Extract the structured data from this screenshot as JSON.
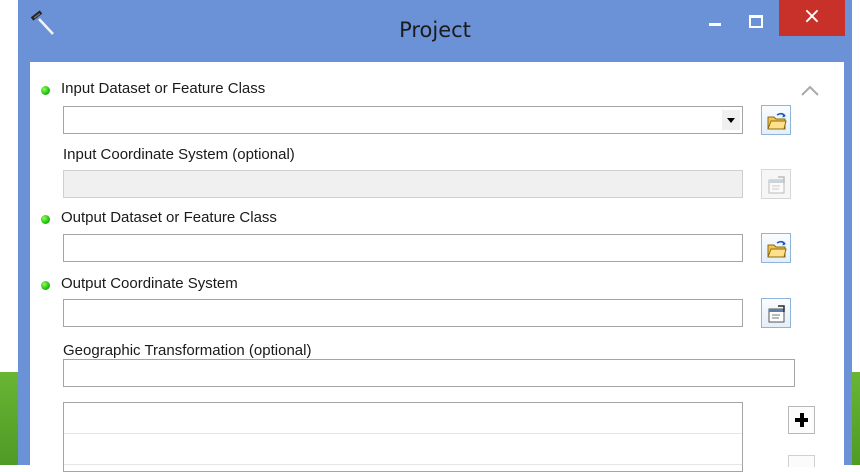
{
  "window": {
    "title": "Project",
    "close_glyph": "×",
    "title_icon": "hammer-icon"
  },
  "fields": [
    {
      "label": "Input Dataset or Feature Class",
      "required": true,
      "value": "",
      "control": "combo",
      "button_icon": "browse-folder-icon"
    },
    {
      "label": "Input Coordinate System (optional)",
      "required": false,
      "value": "",
      "control": "text",
      "enabled": false,
      "button_icon": "spatial-reference-properties-icon"
    },
    {
      "label": "Output Dataset or Feature Class",
      "required": true,
      "value": "",
      "control": "text",
      "button_icon": "browse-folder-icon"
    },
    {
      "label": "Output Coordinate System",
      "required": true,
      "value": "",
      "control": "text",
      "button_icon": "spatial-reference-properties-icon"
    },
    {
      "label": "Geographic Transformation (optional)",
      "required": false,
      "value": "",
      "control": "text"
    }
  ],
  "transformation_list": {
    "rows": [
      "",
      ""
    ],
    "add_button_icon": "plus-icon"
  },
  "colors": {
    "title_bar": "#6b91d6",
    "close_button": "#c7312a",
    "required_dot": "#28c314"
  }
}
